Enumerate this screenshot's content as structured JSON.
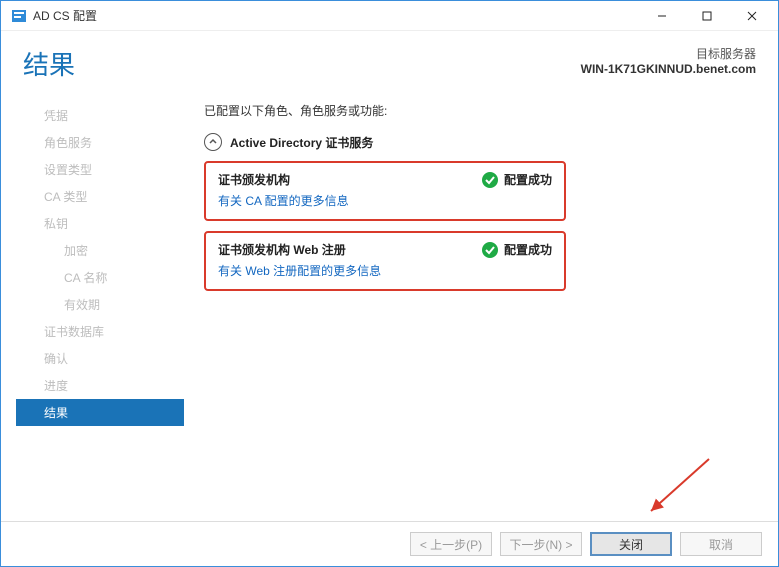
{
  "window": {
    "title": "AD CS 配置"
  },
  "header": {
    "page_title": "结果",
    "target_label": "目标服务器",
    "target_server": "WIN-1K71GKINNUD.benet.com"
  },
  "sidebar": {
    "items": [
      {
        "label": "凭据",
        "active": false,
        "indent": false
      },
      {
        "label": "角色服务",
        "active": false,
        "indent": false
      },
      {
        "label": "设置类型",
        "active": false,
        "indent": false
      },
      {
        "label": "CA 类型",
        "active": false,
        "indent": false
      },
      {
        "label": "私钥",
        "active": false,
        "indent": false
      },
      {
        "label": "加密",
        "active": false,
        "indent": true
      },
      {
        "label": "CA 名称",
        "active": false,
        "indent": true
      },
      {
        "label": "有效期",
        "active": false,
        "indent": true
      },
      {
        "label": "证书数据库",
        "active": false,
        "indent": false
      },
      {
        "label": "确认",
        "active": false,
        "indent": false
      },
      {
        "label": "进度",
        "active": false,
        "indent": false
      },
      {
        "label": "结果",
        "active": true,
        "indent": false
      }
    ]
  },
  "content": {
    "intro": "已配置以下角色、角色服务或功能:",
    "section_title": "Active Directory 证书服务",
    "results": [
      {
        "name": "证书颁发机构",
        "status": "配置成功",
        "link": "有关 CA 配置的更多信息"
      },
      {
        "name": "证书颁发机构 Web 注册",
        "status": "配置成功",
        "link": "有关 Web 注册配置的更多信息"
      }
    ]
  },
  "buttons": {
    "prev": "< 上一步(P)",
    "next": "下一步(N) >",
    "close": "关闭",
    "cancel": "取消"
  },
  "colors": {
    "accent": "#1a73b7",
    "success": "#1faa45",
    "highlight_border": "#d93a2b",
    "annotation": "#d93a2b"
  }
}
